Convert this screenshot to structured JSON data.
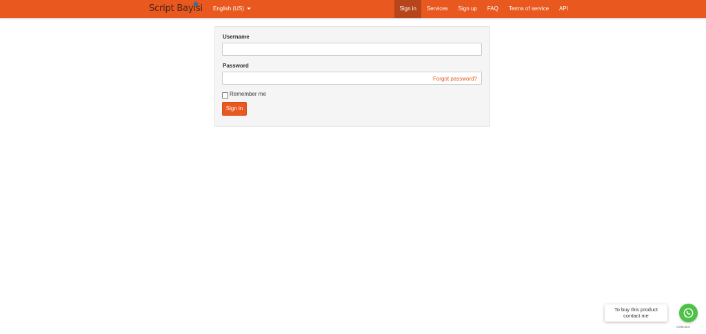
{
  "navbar": {
    "brand": "Script Bayisi",
    "brand_icon": "logo-mark-icon",
    "language": "English (US)",
    "links": [
      {
        "label": "Sign in",
        "active": true
      },
      {
        "label": "Services",
        "active": false
      },
      {
        "label": "Sign up",
        "active": false
      },
      {
        "label": "FAQ",
        "active": false
      },
      {
        "label": "Terms of service",
        "active": false
      },
      {
        "label": "API",
        "active": false
      }
    ]
  },
  "form": {
    "username_label": "Username",
    "username_value": "",
    "password_label": "Password",
    "password_value": "",
    "forgot_password": "Forgot password?",
    "remember_label": "Remember me",
    "remember_checked": false,
    "submit_label": "Sign in"
  },
  "whatsapp": {
    "bubble_line1": "To buy this product",
    "bubble_line2": "contact me",
    "icon": "whatsapp-icon",
    "credit": "GetButton"
  },
  "colors": {
    "accent": "#e8581f",
    "active_tab": "#b7451b",
    "whatsapp_green": "#4dc247"
  }
}
